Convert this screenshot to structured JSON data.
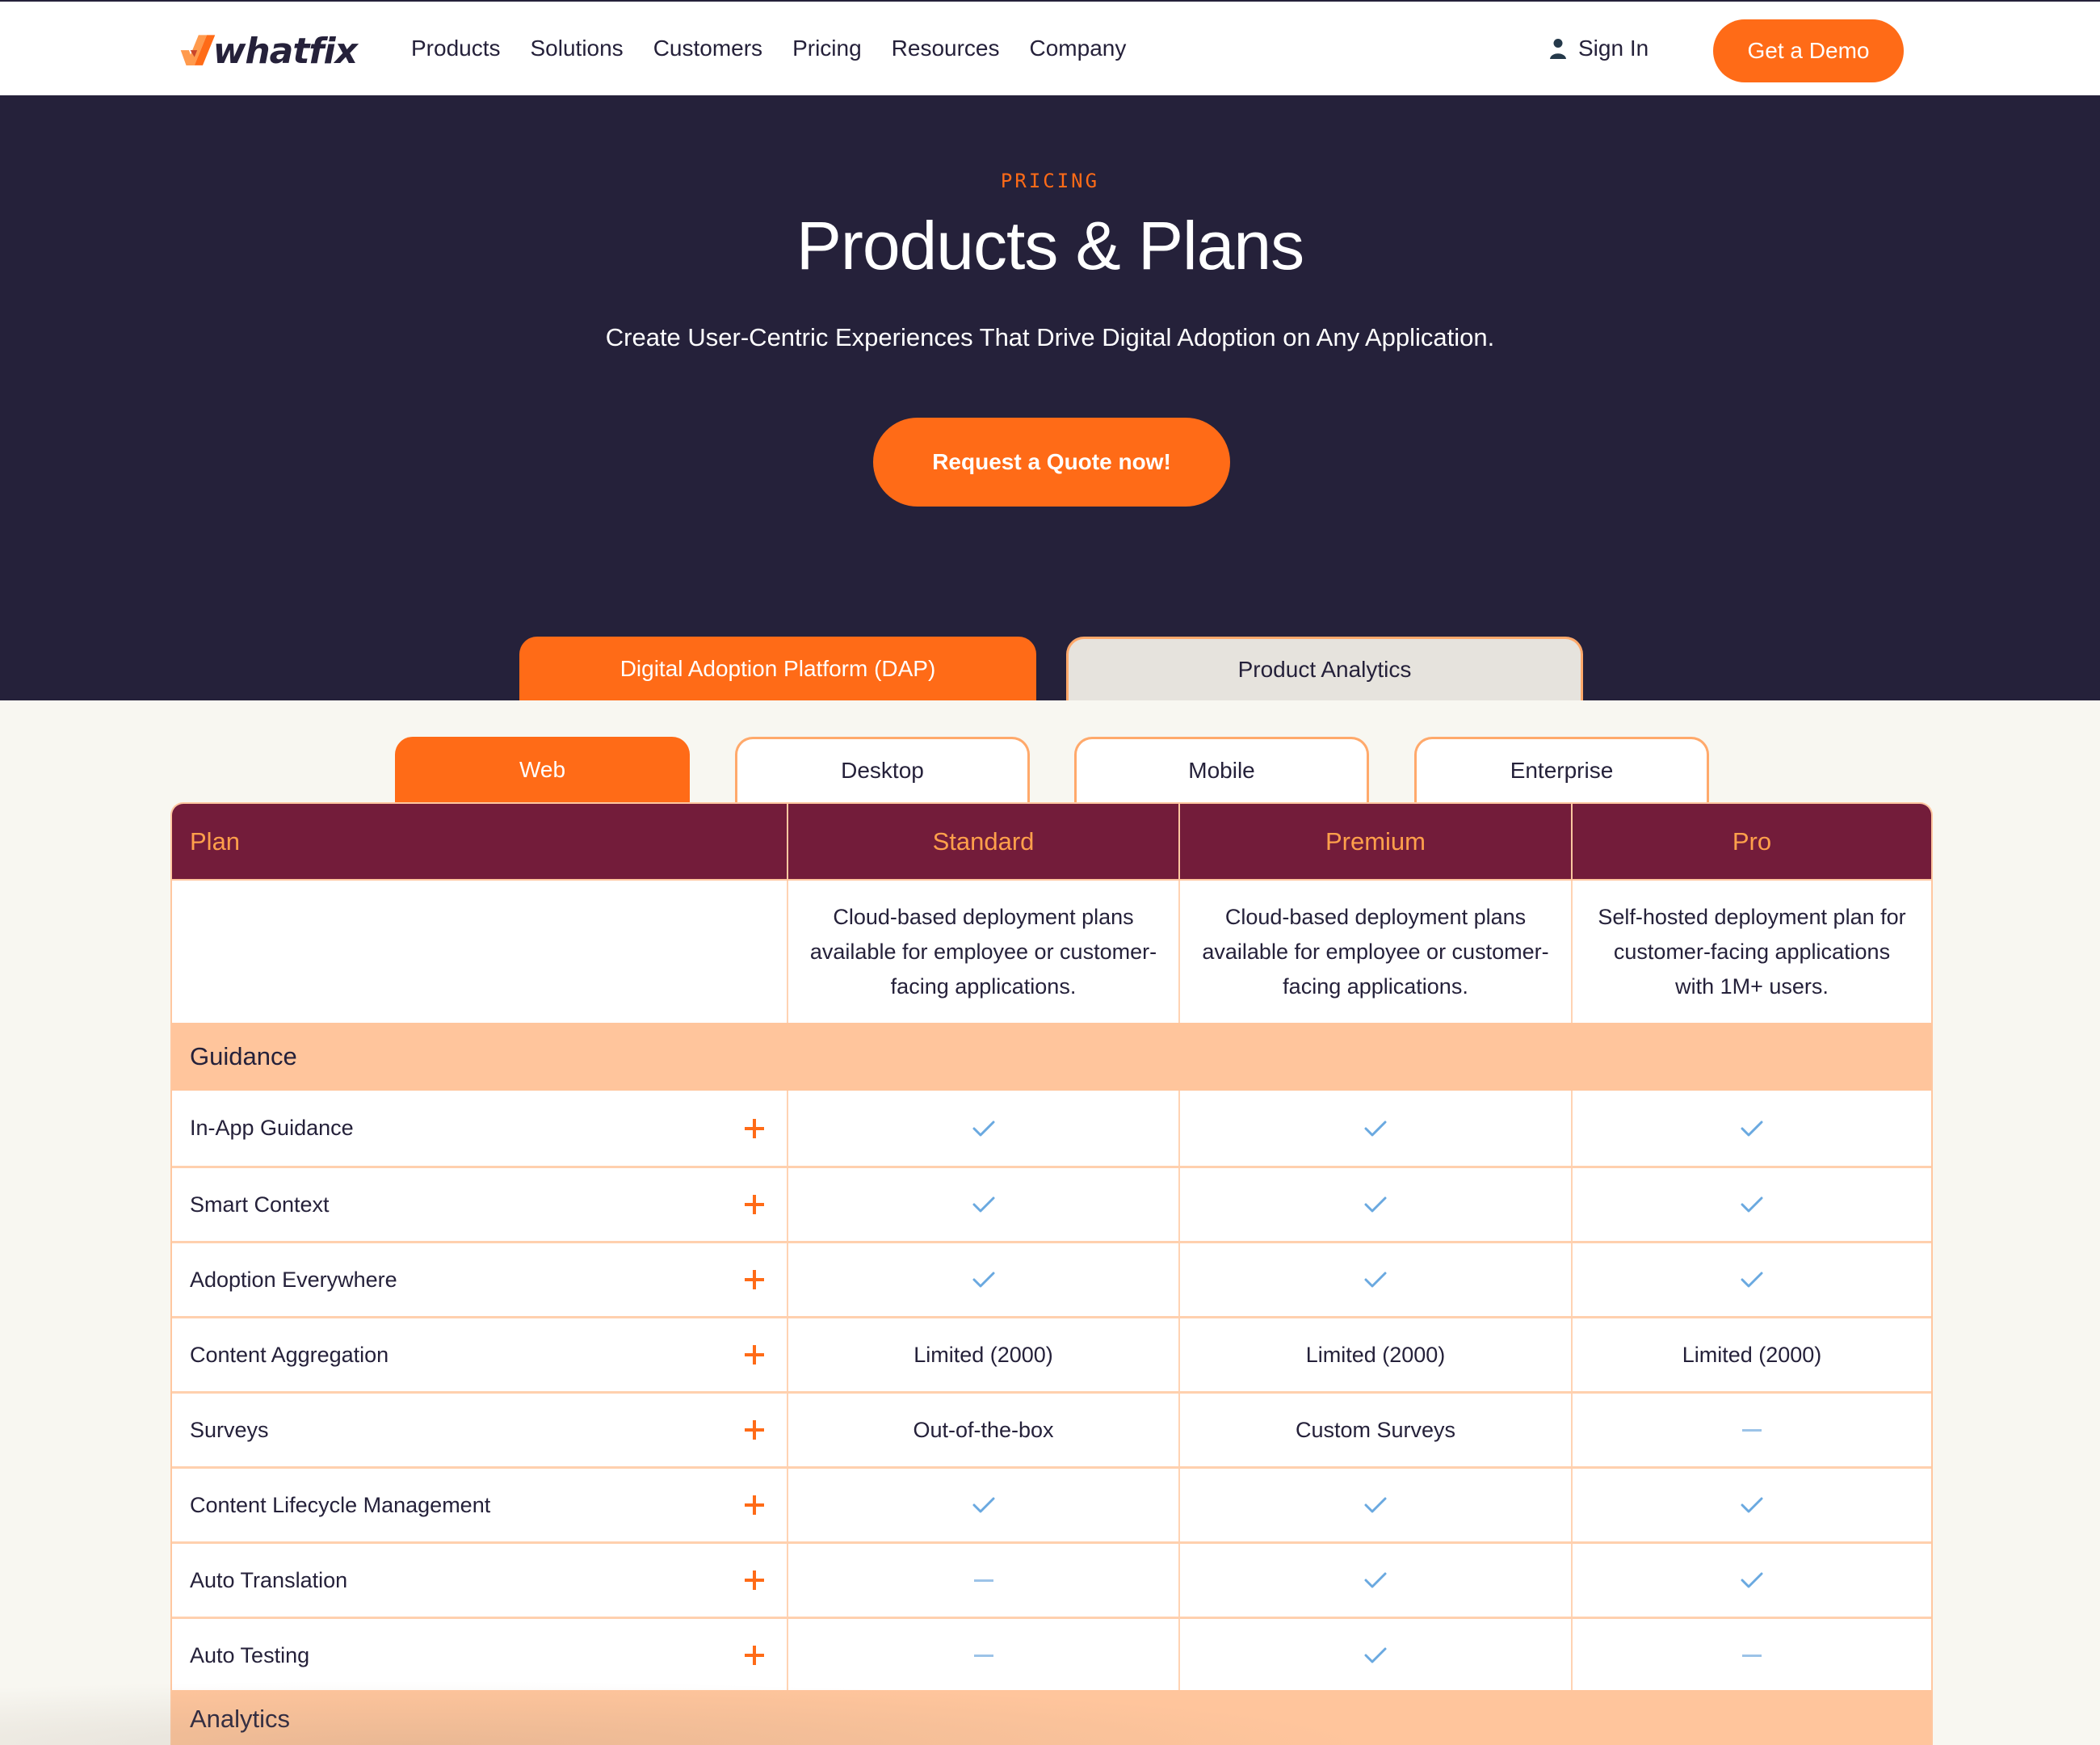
{
  "header": {
    "logo_text": "whatfix",
    "nav": [
      "Products",
      "Solutions",
      "Customers",
      "Pricing",
      "Resources",
      "Company"
    ],
    "sign_in": "Sign In",
    "demo_button": "Get a Demo"
  },
  "hero": {
    "eyebrow": "PRICING",
    "title": "Products & Plans",
    "subtitle": "Create User-Centric Experiences That Drive Digital Adoption on Any Application.",
    "cta": "Request a Quote now!"
  },
  "product_tabs": [
    {
      "label": "Digital Adoption Platform (DAP)",
      "active": true
    },
    {
      "label": "Product Analytics",
      "active": false
    }
  ],
  "platform_tabs": [
    {
      "label": "Web",
      "active": true
    },
    {
      "label": "Desktop",
      "active": false
    },
    {
      "label": "Mobile",
      "active": false
    },
    {
      "label": "Enterprise",
      "active": false
    }
  ],
  "table": {
    "headers": [
      "Plan",
      "Standard",
      "Premium",
      "Pro"
    ],
    "descriptions": [
      "",
      "Cloud-based deployment plans available for employee or customer-facing applications.",
      "Cloud-based deployment plans available for employee or customer-facing applications.",
      "Self-hosted deployment plan for customer-facing applications with 1M+ users."
    ],
    "sections": [
      {
        "name": "Guidance",
        "features": [
          {
            "name": "In-App Guidance",
            "values": [
              "check",
              "check",
              "check"
            ]
          },
          {
            "name": "Smart Context",
            "values": [
              "check",
              "check",
              "check"
            ]
          },
          {
            "name": "Adoption Everywhere",
            "values": [
              "check",
              "check",
              "check"
            ]
          },
          {
            "name": "Content Aggregation",
            "values": [
              "Limited (2000)",
              "Limited (2000)",
              "Limited (2000)"
            ]
          },
          {
            "name": "Surveys",
            "values": [
              "Out-of-the-box",
              "Custom Surveys",
              "dash"
            ]
          },
          {
            "name": "Content Lifecycle Management",
            "values": [
              "check",
              "check",
              "check"
            ]
          },
          {
            "name": "Auto Translation",
            "values": [
              "dash",
              "check",
              "check"
            ]
          },
          {
            "name": "Auto Testing",
            "values": [
              "dash",
              "check",
              "dash"
            ]
          }
        ]
      },
      {
        "name": "Analytics",
        "features": []
      }
    ]
  },
  "colors": {
    "brand_orange": "#ff6b17",
    "hero_bg": "#25213a",
    "table_header_bg": "#731c3a",
    "table_header_text": "#ffa04b",
    "section_bg": "#ffc59c",
    "check": "#6aa9e0"
  }
}
